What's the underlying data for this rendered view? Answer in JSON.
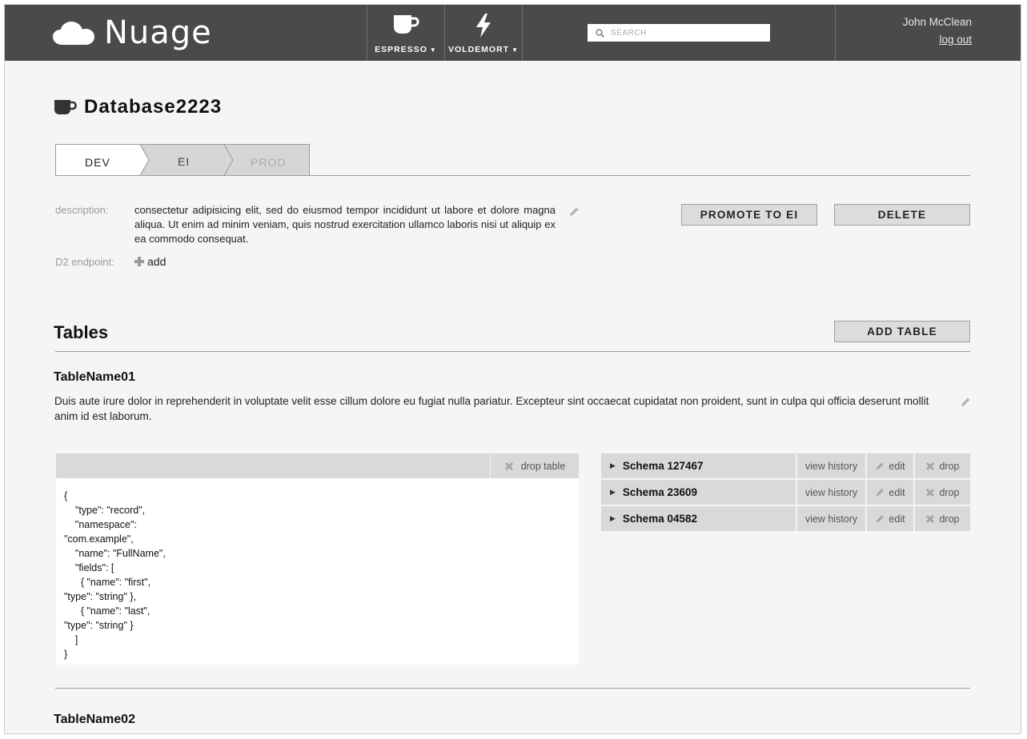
{
  "header": {
    "brand": "Nuage",
    "nav": [
      {
        "label": "ESPRESSO",
        "icon": "coffee-cup-icon"
      },
      {
        "label": "VOLDEMORT",
        "icon": "lightning-bolt-icon"
      }
    ],
    "search_placeholder": "SEARCH",
    "user_name": "John McClean",
    "logout_label": "log out"
  },
  "database": {
    "name": "Database2223",
    "env_tabs": [
      {
        "label": "DEV",
        "state": "active"
      },
      {
        "label": "EI",
        "state": "available"
      },
      {
        "label": "PROD",
        "state": "disabled"
      }
    ],
    "description_label": "description:",
    "description": "consectetur adipisicing elit, sed do eiusmod tempor incididunt ut labore et dolore magna aliqua. Ut enim ad minim veniam, quis nostrud exercitation ullamco laboris nisi ut aliquip ex ea commodo consequat.",
    "endpoint_label": "D2 endpoint:",
    "add_label": "add",
    "promote_label": "PROMOTE TO EI",
    "delete_label": "DELETE"
  },
  "tables_section": {
    "title": "Tables",
    "add_table_label": "ADD TABLE",
    "tables": [
      {
        "name": "TableName01",
        "description": "Duis aute irure dolor in reprehenderit in voluptate velit esse cillum dolore eu fugiat nulla pariatur. Excepteur sint occaecat cupidatat non proident, sunt in culpa qui officia deserunt mollit anim id est laborum.",
        "drop_table_label": "drop table",
        "schema_code": "{\n    \"type\": \"record\",\n    \"namespace\":\n\"com.example\",\n    \"name\": \"FullName\",\n    \"fields\": [\n      { \"name\": \"first\",\n\"type\": \"string\" },\n      { \"name\": \"last\",\n\"type\": \"string\" }\n    ]\n}",
        "schemas": [
          {
            "name": "Schema 127467",
            "history_label": "view history",
            "edit_label": "edit",
            "drop_label": "drop"
          },
          {
            "name": "Schema 23609",
            "history_label": "view history",
            "edit_label": "edit",
            "drop_label": "drop"
          },
          {
            "name": "Schema 04582",
            "history_label": "view history",
            "edit_label": "edit",
            "drop_label": "drop"
          }
        ]
      },
      {
        "name": "TableName02"
      }
    ]
  },
  "colors": {
    "header_bg": "#4a4a4a",
    "page_bg": "#f5f5f5",
    "button_bg": "#dcdcdc",
    "row_bg": "#d9d9d9"
  }
}
